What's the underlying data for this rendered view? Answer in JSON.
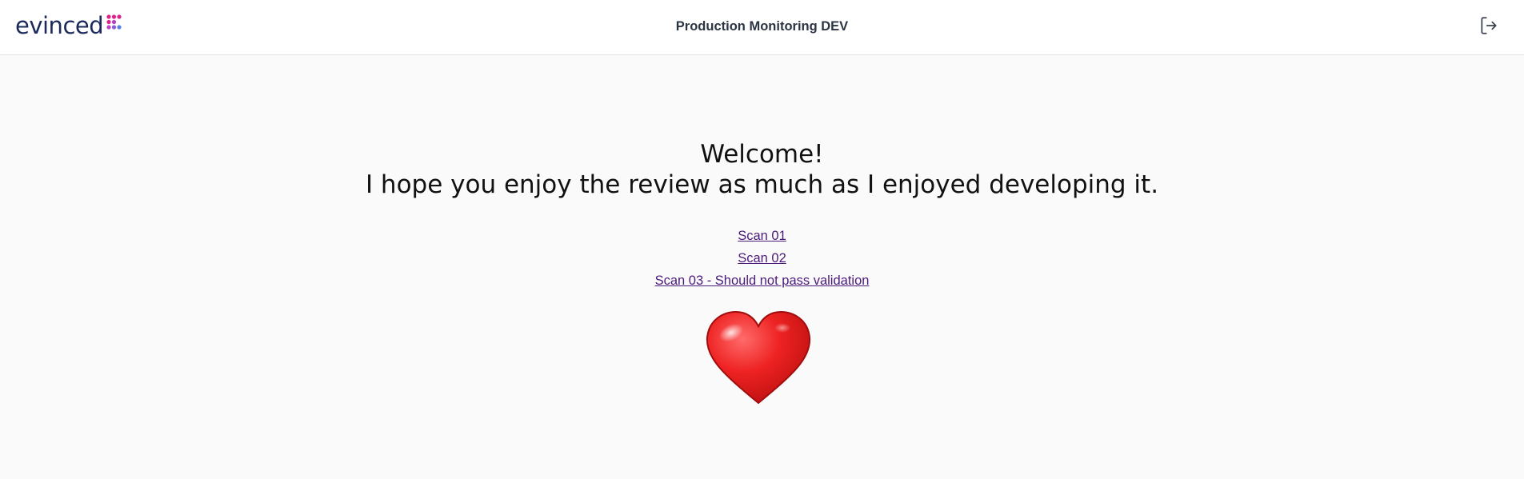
{
  "header": {
    "logo_text": "evinced",
    "title": "Production Monitoring DEV",
    "logout_icon": "logout-icon"
  },
  "main": {
    "welcome_line1": "Welcome!",
    "welcome_line2": "I hope you enjoy the review as much as I enjoyed developing it.",
    "links": [
      {
        "label": "Scan 01"
      },
      {
        "label": "Scan 02"
      },
      {
        "label": "Scan 03 - Should not pass validation"
      }
    ],
    "heart_icon": "heart-emoji"
  },
  "colors": {
    "brand_text": "#1b2a5b",
    "link": "#4c1b7a",
    "heart": "#e01b1b",
    "background": "#fafafa"
  }
}
